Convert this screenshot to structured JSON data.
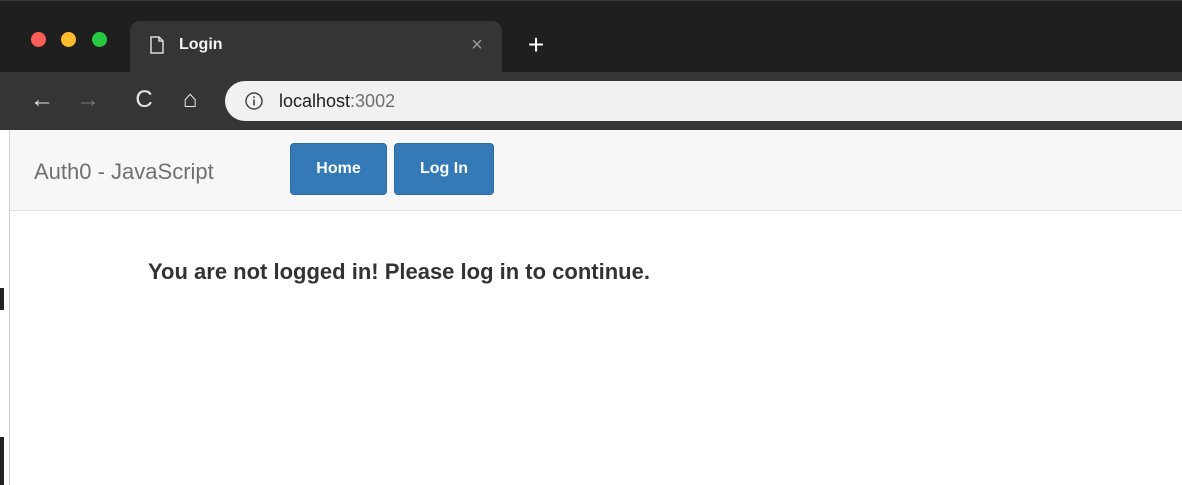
{
  "browser": {
    "tab": {
      "title": "Login",
      "close_glyph": "×"
    },
    "new_tab_glyph": "+",
    "nav": {
      "back_glyph": "←",
      "forward_glyph": "→",
      "reload_glyph": "C",
      "home_glyph": "⌂"
    },
    "address": {
      "host": "localhost",
      "port": ":3002"
    },
    "colors": {
      "close": "#fe5f57",
      "minimize": "#febc2e",
      "zoom": "#28c840"
    }
  },
  "app": {
    "brand": "Auth0 - JavaScript",
    "nav_buttons": {
      "home": "Home",
      "login": "Log In"
    },
    "message": "You are not logged in! Please log in to continue.",
    "accent_color": "#337ab7"
  }
}
